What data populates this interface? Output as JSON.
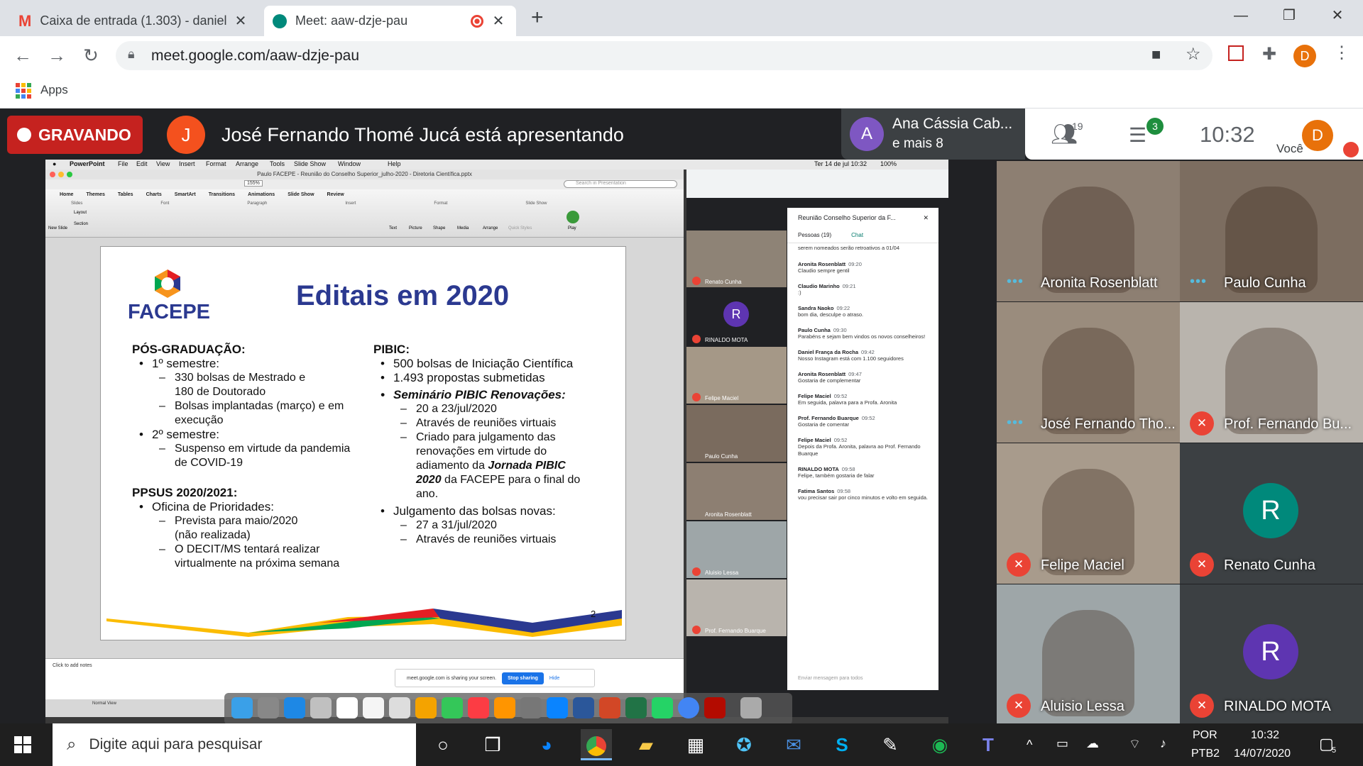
{
  "browser": {
    "tabs": [
      {
        "title": "Caixa de entrada (1.303) - daniel",
        "active": false
      },
      {
        "title": "Meet: aaw-dzje-pau",
        "active": true
      }
    ],
    "url": "meet.google.com/aaw-dzje-pau",
    "bookmarks_label": "Apps",
    "profile_letter": "D"
  },
  "meet": {
    "recording_label": "GRAVANDO",
    "presenter_initial": "J",
    "presenting_text": "José Fernando Thomé Jucá está apresentando",
    "speaker_initial": "A",
    "speaker_name": "Ana Cássia Cab...",
    "speaker_more": "e mais 8",
    "people_count": "19",
    "chat_badge": "3",
    "time": "10:32",
    "self_label": "Você",
    "self_initial": "D",
    "colors": {
      "recording": "#c5221f",
      "mic_off": "#ea4335",
      "presenter_avatar": "#f4511e",
      "speaker_avatar": "#7e57c2"
    }
  },
  "mac": {
    "menu": [
      "PowerPoint",
      "File",
      "Edit",
      "View",
      "Insert",
      "Format",
      "Arrange",
      "Tools",
      "Slide Show",
      "Window",
      "Help"
    ],
    "clock": "Ter 14 de jul 10:32",
    "battery": "100%"
  },
  "powerpoint": {
    "doc_title": "Paulo FACEPE - Reunião do Conselho Superior_julho-2020 - Diretoria Científica.pptx",
    "zoom": "155%",
    "search_placeholder": "Search in Presentation",
    "ribbon_tabs": [
      "Home",
      "Themes",
      "Tables",
      "Charts",
      "SmartArt",
      "Transitions",
      "Animations",
      "Slide Show",
      "Review"
    ],
    "ribbon_groups": [
      "Slides",
      "Font",
      "Paragraph",
      "Insert",
      "Format",
      "Slide Show"
    ],
    "ribbon_buttons": [
      "New Slide",
      "Layout",
      "Section",
      "Text",
      "Picture",
      "Shape",
      "Media",
      "Arrange",
      "Quick Styles",
      "Play"
    ],
    "notes_placeholder": "Click to add notes",
    "view_label": "Normal View",
    "share_bar_text": "meet.google.com is sharing your screen.",
    "stop_sharing": "Stop sharing",
    "hide": "Hide"
  },
  "slide": {
    "logo_text": "FACEPE",
    "title": "Editais em 2020",
    "page_number": "2",
    "left": {
      "heading1": "PÓS-GRADUAÇÃO:",
      "sem1": "1º semestre:",
      "sem1_a": "330 bolsas de Mestrado e",
      "sem1_a2": "180 de Doutorado",
      "sem1_b": "Bolsas implantadas (março) e em",
      "sem1_b2": "execução",
      "sem2": "2º semestre:",
      "sem2_a": "Suspenso em virtude da pandemia",
      "sem2_a2": "de COVID-19",
      "heading2": "PPSUS 2020/2021:",
      "oficina": "Oficina de Prioridades:",
      "of_a": "Prevista para maio/2020",
      "of_a2": "(não realizada)",
      "of_b": "O DECIT/MS tentará realizar",
      "of_b2": "virtualmente na próxima semana"
    },
    "right": {
      "heading": "PIBIC:",
      "b1": "500 bolsas de Iniciação Científica",
      "b2": "1.493 propostas submetidas",
      "b3": "Seminário PIBIC Renovações:",
      "b3_a": "20 a 23/jul/2020",
      "b3_b": "Através de reuniões virtuais",
      "b3_c1": "Criado para julgamento das",
      "b3_c2": "renovações em virtude do",
      "b3_c3": "adiamento da",
      "b3_c3b": "Jornada PIBIC",
      "b3_c4b": "2020",
      "b3_c4": "da FACEPE para o final do",
      "b3_c5": "ano.",
      "b4": "Julgamento das bolsas novas:",
      "b4_a": "27 a 31/jul/2020",
      "b4_b": "Através de reuniões virtuais"
    }
  },
  "inner_meet": {
    "chat_title": "Reunião Conselho Superior da F...",
    "people_tab": "Pessoas (19)",
    "chat_tab": "Chat",
    "prev_line": "serem nomeados serão retroativos a 01/04",
    "input_placeholder": "Enviar mensagem para todos",
    "messages": [
      {
        "name": "Aronita Rosenblatt",
        "time": "09:20",
        "text": "Claudio sempre gentil"
      },
      {
        "name": "Claudio Marinho",
        "time": "09:21",
        "text": ":)"
      },
      {
        "name": "Sandra Naoko",
        "time": "09:22",
        "text": "bom dia, desculpe o atraso."
      },
      {
        "name": "Paulo Cunha",
        "time": "09:30",
        "text": "Parabéns e sejam bem vindos os novos conselheiros!"
      },
      {
        "name": "Daniel França da Rocha",
        "time": "09:42",
        "text": "Nosso Instagram está com 1.100 seguidores"
      },
      {
        "name": "Aronita Rosenblatt",
        "time": "09:47",
        "text": "Gostaria de complementar"
      },
      {
        "name": "Felipe Maciel",
        "time": "09:52",
        "text": "Em seguida, palavra para a Profa. Aronita"
      },
      {
        "name": "Prof. Fernando Buarque",
        "time": "09:52",
        "text": "Gostaria de comentar"
      },
      {
        "name": "Felipe Maciel",
        "time": "09:52",
        "text": "Depois da Profa. Aronita, palavra ao Prof. Fernando Buarque"
      },
      {
        "name": "RINALDO MOTA",
        "time": "09:58",
        "text": "Felipe, também gostaria de falar"
      },
      {
        "name": "Fatima Santos",
        "time": "09:58",
        "text": "vou precisar sair por cinco minutos e volto em seguida."
      }
    ],
    "participants": [
      {
        "name": "Renato Cunha",
        "initial": ""
      },
      {
        "name": "RINALDO MOTA",
        "initial": "R"
      },
      {
        "name": "Felipe Maciel",
        "initial": ""
      },
      {
        "name": "Paulo Cunha",
        "initial": ""
      },
      {
        "name": "Aronita Rosenblatt",
        "initial": ""
      },
      {
        "name": "Aluisio Lessa",
        "initial": ""
      },
      {
        "name": "Prof. Fernando Buarque",
        "initial": ""
      }
    ]
  },
  "tiles": [
    {
      "name": "Aronita Rosenblatt",
      "state": "speaking",
      "bg": "#8d7f72"
    },
    {
      "name": "Paulo Cunha",
      "state": "speaking",
      "bg": "#7c6d60"
    },
    {
      "name": "José Fernando Tho...",
      "state": "speaking",
      "bg": "#9a8c7d"
    },
    {
      "name": "Prof. Fernando Bu...",
      "state": "muted",
      "bg": "#b9b4ad"
    },
    {
      "name": "Felipe Maciel",
      "state": "muted",
      "bg": "#a89b8c"
    },
    {
      "name": "Renato Cunha",
      "state": "muted",
      "initial": "R",
      "avatar": "#00897b",
      "bg": "#3c4043"
    },
    {
      "name": "Aluisio Lessa",
      "state": "muted",
      "bg": "#9ea6a8"
    },
    {
      "name": "RINALDO MOTA",
      "state": "muted",
      "initial": "R",
      "avatar": "#5e35b1",
      "bg": "#3c4043"
    }
  ],
  "taskbar": {
    "search_placeholder": "Digite aqui para pesquisar",
    "lang": "POR",
    "lang2": "PTB2",
    "time": "10:32",
    "date": "14/07/2020",
    "notif_count": "5"
  }
}
